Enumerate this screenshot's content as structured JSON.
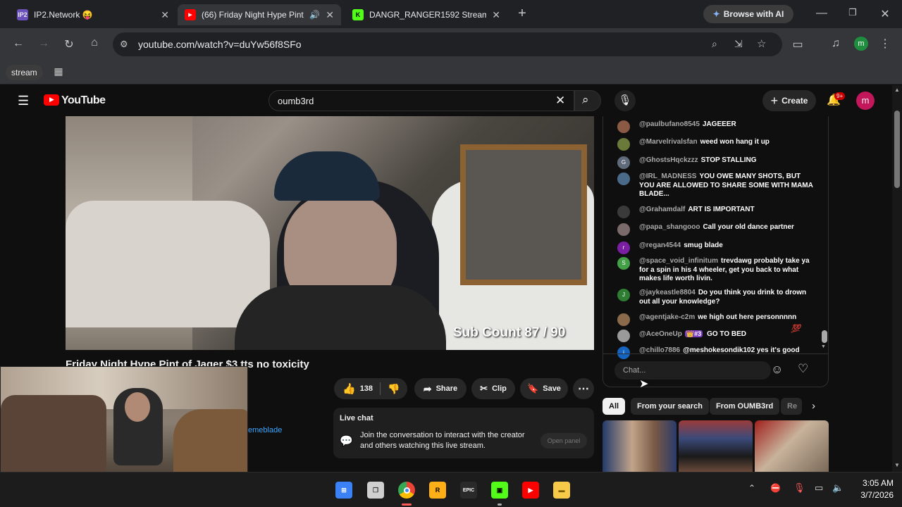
{
  "browser": {
    "tabs": [
      {
        "title": "IP2.Network 😝",
        "fav_text": "IP2",
        "fav_color": "#6b4fbb"
      },
      {
        "title": "(66) Friday Night Hype Pint",
        "fav_text": "▶",
        "fav_color": "#ff0000"
      },
      {
        "title": "DANGR_RANGER1592 Stream -",
        "fav_text": "K",
        "fav_color": "#53fc18"
      }
    ],
    "new_tab": "+",
    "browse_ai": "Browse with AI",
    "url": "youtube.com/watch?v=duYw56f8SFo",
    "profile_initial": "m",
    "bookmark": "stream"
  },
  "youtube": {
    "logo": "YouTube",
    "search_value": "oumb3rd",
    "create_label": "Create",
    "notif_count": "9+",
    "avatar_initial": "m",
    "video_overlay": "Sub Count  87 / 90",
    "title": "Friday Night Hype Pint of Jager $3 tts no toxicity",
    "likes": "138",
    "share": "Share",
    "clip": "Clip",
    "save": "Save",
    "channel_fragment": "emeblade",
    "live_chat_title": "Live chat",
    "live_chat_desc": "Join the conversation to interact with the creator and others watching this live stream.",
    "open_panel": "Open panel",
    "chat_placeholder": "Chat...",
    "chips": [
      "All",
      "From your search",
      "From OUMB3rd",
      "Re"
    ]
  },
  "chat_messages": [
    {
      "author": "@paulbufano8545",
      "text": "JAGEEER",
      "av": "",
      "color": "#8a5a44"
    },
    {
      "author": "@Marvelrivalsfan",
      "text": "weed won hang it up",
      "av": "",
      "color": "#6a7a3a"
    },
    {
      "author": "@GhostsHqckzzz",
      "text": "STOP STALLING",
      "av": "G",
      "color": "#5f6b7a"
    },
    {
      "author": "@IRL_MADNESS",
      "text": "YOU OWE MANY SHOTS, BUT YOU ARE ALLOWED TO SHARE SOME WITH MAMA BLADE...",
      "av": "",
      "color": "#4a6a8a"
    },
    {
      "author": "@Grahamdalf",
      "text": "ART IS IMPORTANT",
      "av": "",
      "color": "#3a3a3a"
    },
    {
      "author": "@papa_shangooo",
      "text": "Call your old dance partner",
      "av": "",
      "color": "#7a6a6a"
    },
    {
      "author": "@regan4544",
      "text": "smug blade",
      "av": "r",
      "color": "#7b1fa2"
    },
    {
      "author": "@space_void_infinitum",
      "text": "trevdawg probably take ya for a spin in his 4 wheeler, get you back to what makes life worth livin.",
      "av": "S",
      "color": "#43a047"
    },
    {
      "author": "@jaykeastle8804",
      "text": "Do you think you drink to drown out all your knowledge?",
      "av": "J",
      "color": "#2e7d32"
    },
    {
      "author": "@agentjake-c2m",
      "text": "we high out here personnnnn",
      "av": "",
      "color": "#8a6a4a"
    },
    {
      "author": "@AceOneUp",
      "text": "GO TO BED",
      "av": "",
      "color": "#9a9a9a",
      "badge": "👑#3"
    },
    {
      "author": "@chillo7886",
      "text": "@meshokesondik102 yes it's good",
      "av": "i",
      "color": "#1565c0"
    }
  ],
  "taskbar": {
    "time": "3:05 AM",
    "date": "3/7/2026"
  },
  "colors": {
    "accent_red": "#ff0000",
    "profile_green": "#1e8e3e",
    "yt_avatar": "#c2185b"
  }
}
